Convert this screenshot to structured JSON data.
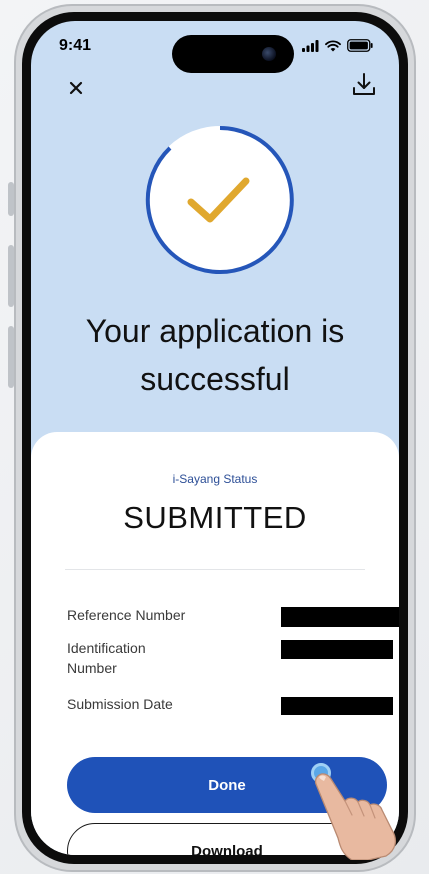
{
  "status_bar": {
    "time": "9:41"
  },
  "header": {
    "close_icon": "close-icon",
    "download_icon": "download-icon"
  },
  "success": {
    "icon": "checkmark-icon",
    "headline": "Your application is successful",
    "accent_color": "#e0a82e",
    "ring_color": "#2556b9"
  },
  "card": {
    "status_label": "i-Sayang Status",
    "status_value": "SUBMITTED",
    "rows": [
      {
        "label": "Reference Number",
        "value": ""
      },
      {
        "label": "Identification Number",
        "value": ""
      },
      {
        "label": "Submission Date",
        "value": ""
      }
    ]
  },
  "actions": {
    "done_label": "Done",
    "download_label": "Download",
    "primary_color": "#1f52b8"
  }
}
